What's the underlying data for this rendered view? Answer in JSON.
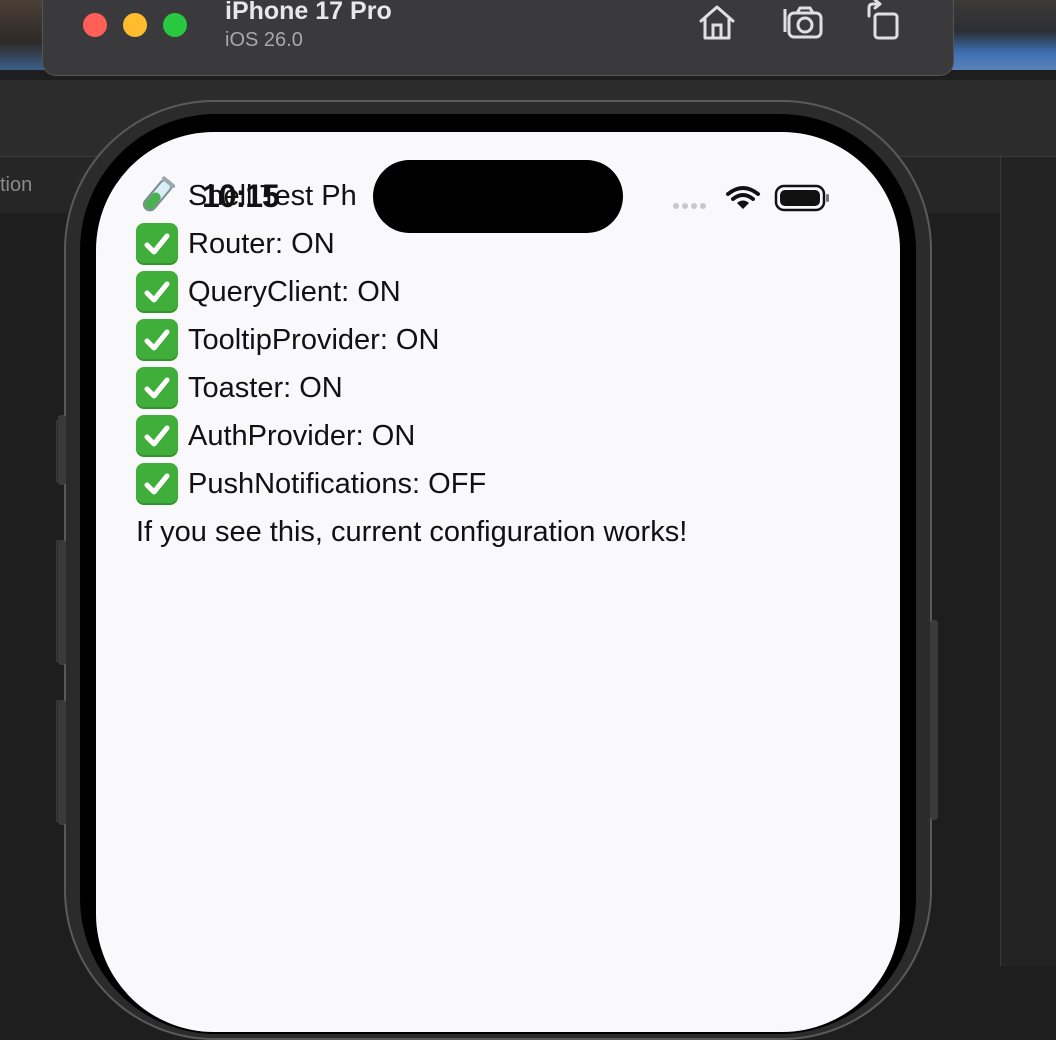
{
  "simulator": {
    "device_name": "iPhone 17 Pro",
    "os_version": "iOS 26.0",
    "toolbar_icons": [
      "home-icon",
      "screenshot-icon",
      "rotate-icon"
    ]
  },
  "background_app": {
    "tab_fragment": "tion"
  },
  "status_bar": {
    "time": "10:15"
  },
  "app": {
    "title": "Shell Test Ph",
    "features": [
      {
        "icon": "check-mark-icon",
        "label": "Router: ON"
      },
      {
        "icon": "check-mark-icon",
        "label": "QueryClient: ON"
      },
      {
        "icon": "check-mark-icon",
        "label": "TooltipProvider: ON"
      },
      {
        "icon": "check-mark-icon",
        "label": "Toaster: ON"
      },
      {
        "icon": "check-mark-icon",
        "label": "AuthProvider: ON"
      },
      {
        "icon": "check-mark-icon",
        "label": "PushNotifications: OFF"
      }
    ],
    "message": "If you see this, current configuration works!"
  },
  "colors": {
    "check_green": "#3fae3a",
    "traffic_red": "#ff5f57",
    "traffic_yellow": "#febc2e",
    "traffic_green": "#28c840"
  }
}
